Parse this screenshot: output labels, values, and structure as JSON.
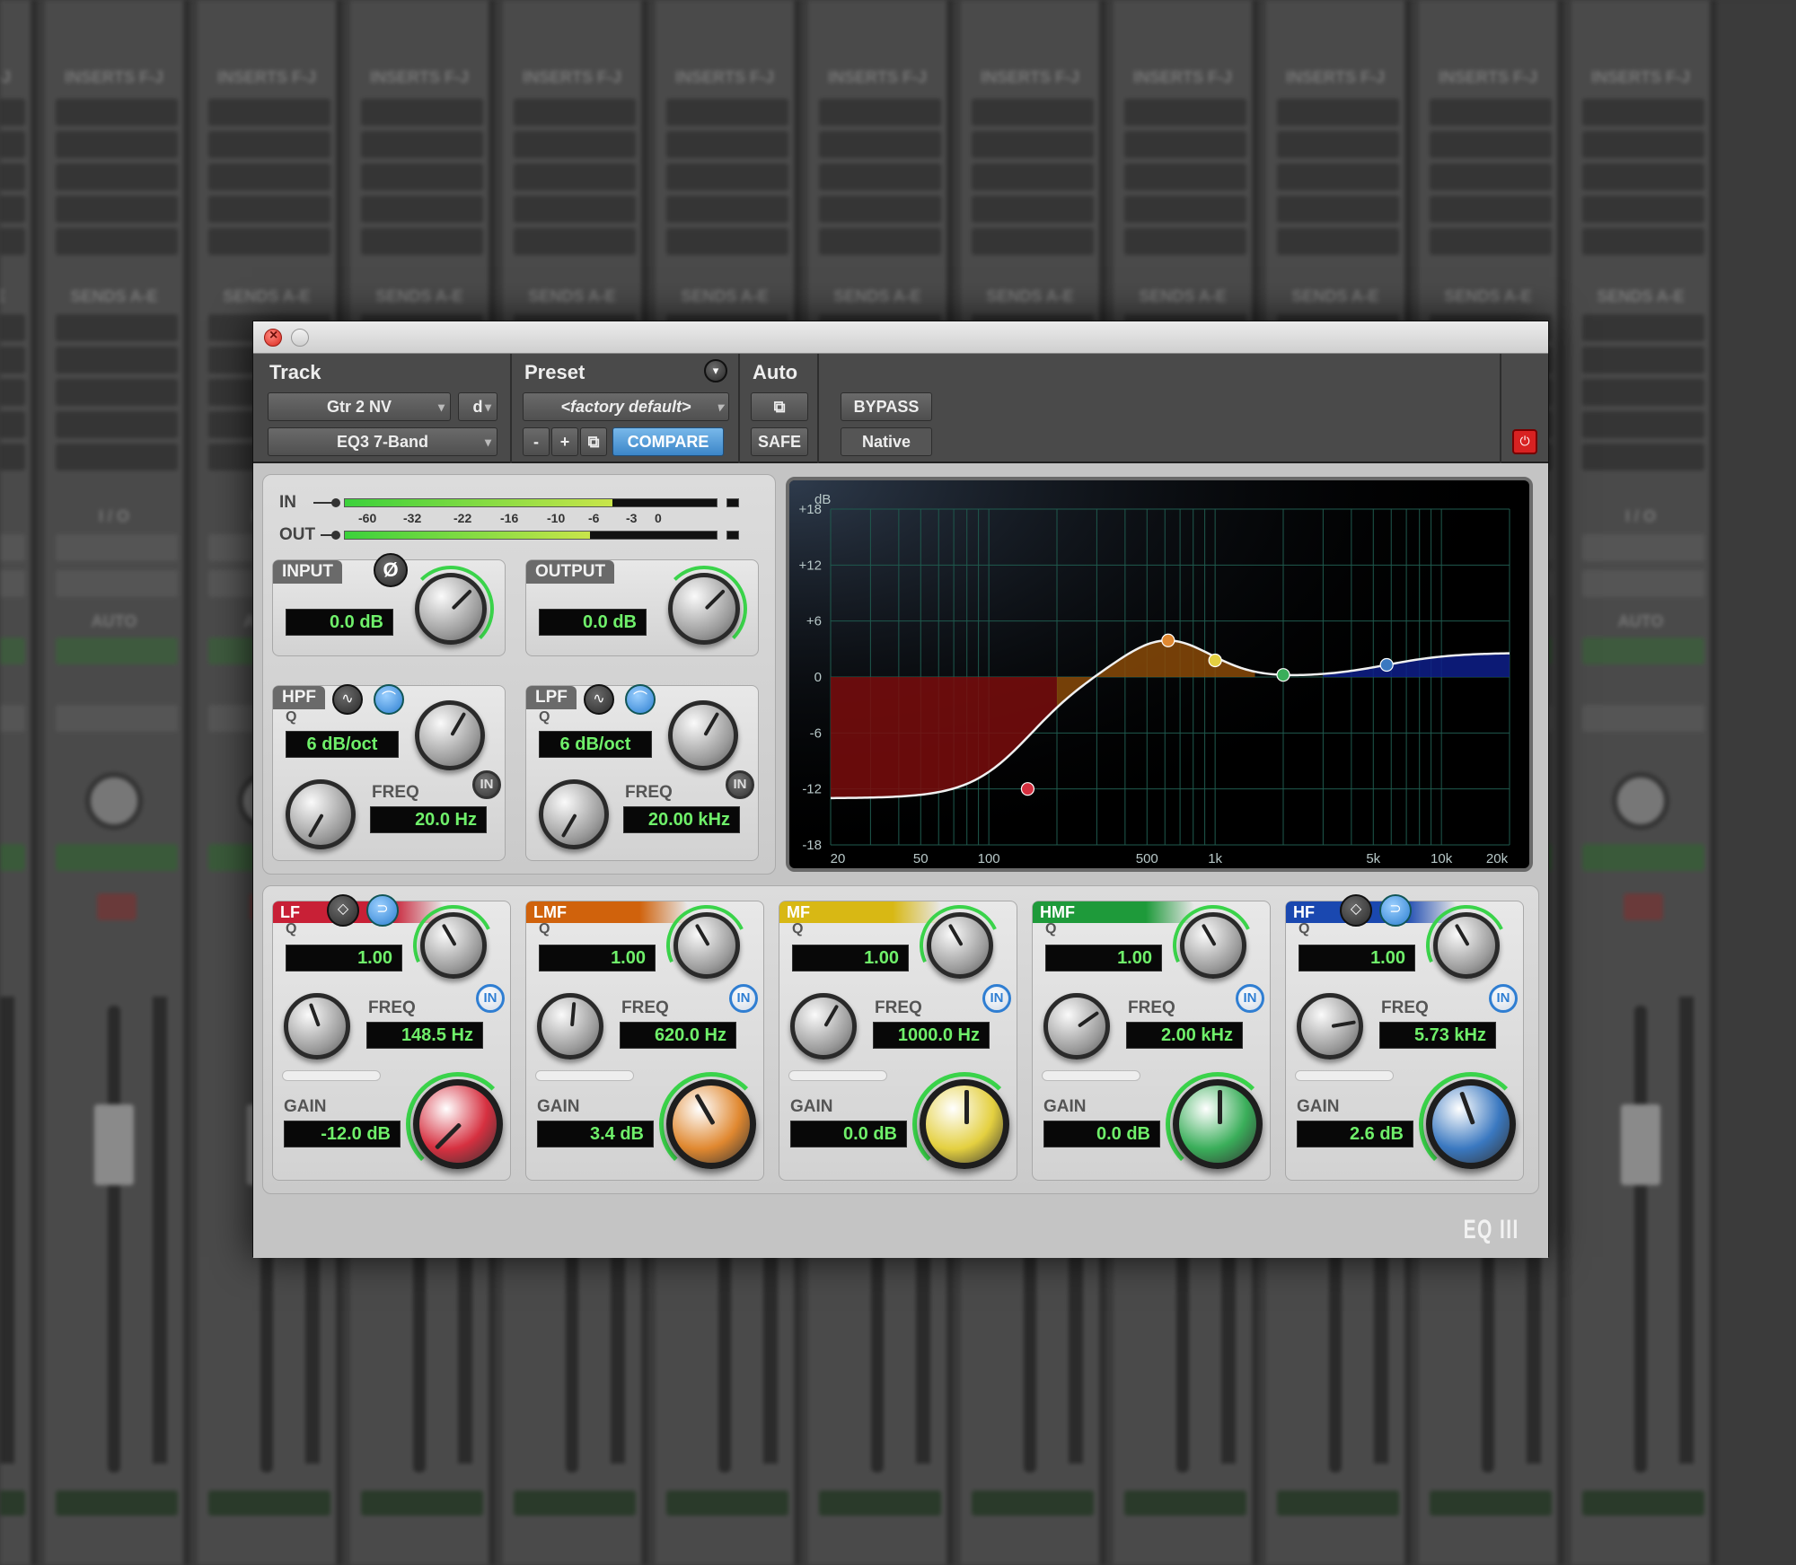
{
  "background": {
    "strip_labels": [
      "INSERTS F-J",
      "SENDS A-E",
      "I / O",
      "AUTO"
    ],
    "strip_count": 12
  },
  "window": {
    "track_label": "Track",
    "track_name": "Gtr 2 NV",
    "track_channel": "d",
    "plugin_name": "EQ3 7-Band",
    "preset_label": "Preset",
    "preset_name": "<factory default>",
    "preset_minus": "-",
    "preset_plus": "+",
    "compare_label": "COMPARE",
    "auto_label": "Auto",
    "safe_label": "SAFE",
    "bypass_label": "BYPASS",
    "native_label": "Native",
    "logo": "EQ III"
  },
  "meters": {
    "in_label": "IN",
    "out_label": "OUT",
    "ticks": [
      "-60",
      "-32",
      "-22",
      "-16",
      "-10",
      "-6",
      "-3",
      "0"
    ],
    "in_level": 0.72,
    "out_level": 0.66
  },
  "io": {
    "input_label": "INPUT",
    "input_value": "0.0 dB",
    "output_label": "OUTPUT",
    "output_value": "0.0 dB",
    "phase_icon": "Ø"
  },
  "filters": {
    "hpf": {
      "label": "HPF",
      "q_label": "Q",
      "q_value": "6 dB/oct",
      "freq_label": "FREQ",
      "freq_value": "20.0 Hz",
      "in_label": "IN"
    },
    "lpf": {
      "label": "LPF",
      "q_label": "Q",
      "q_value": "6 dB/oct",
      "freq_label": "FREQ",
      "freq_value": "20.00 kHz",
      "in_label": "IN"
    }
  },
  "bands": [
    {
      "label": "LF",
      "q_label": "Q",
      "q": "1.00",
      "freq_label": "FREQ",
      "freq": "148.5 Hz",
      "gain_label": "GAIN",
      "gain": "-12.0 dB",
      "in_label": "IN",
      "color": "#c82036",
      "knob": "#d63040"
    },
    {
      "label": "LMF",
      "q_label": "Q",
      "q": "1.00",
      "freq_label": "FREQ",
      "freq": "620.0 Hz",
      "gain_label": "GAIN",
      "gain": "3.4 dB",
      "in_label": "IN",
      "color": "#d0620c",
      "knob": "#e08830"
    },
    {
      "label": "MF",
      "q_label": "Q",
      "q": "1.00",
      "freq_label": "FREQ",
      "freq": "1000.0 Hz",
      "gain_label": "GAIN",
      "gain": "0.0 dB",
      "in_label": "IN",
      "color": "#d8b814",
      "knob": "#e4d040"
    },
    {
      "label": "HMF",
      "q_label": "Q",
      "q": "1.00",
      "freq_label": "FREQ",
      "freq": "2.00 kHz",
      "gain_label": "GAIN",
      "gain": "0.0 dB",
      "in_label": "IN",
      "color": "#1e9a3a",
      "knob": "#3aae5a"
    },
    {
      "label": "HF",
      "q_label": "Q",
      "q": "1.00",
      "freq_label": "FREQ",
      "freq": "5.73 kHz",
      "gain_label": "GAIN",
      "gain": "2.6 dB",
      "in_label": "IN",
      "color": "#1a48b0",
      "knob": "#3a78c0"
    }
  ],
  "graph": {
    "unit_label": "dB",
    "db_ticks": [
      "+18",
      "+12",
      "+6",
      "0",
      "-6",
      "-12",
      "-18"
    ],
    "freq_ticks": [
      "20",
      "50",
      "100",
      "500",
      "1k",
      "5k",
      "10k",
      "20k"
    ],
    "lf_fill": "#7a0d0d",
    "lmf_fill": "#8a4a08",
    "hf_fill": "#0e1e8a",
    "curve": "#f0f0f0"
  }
}
